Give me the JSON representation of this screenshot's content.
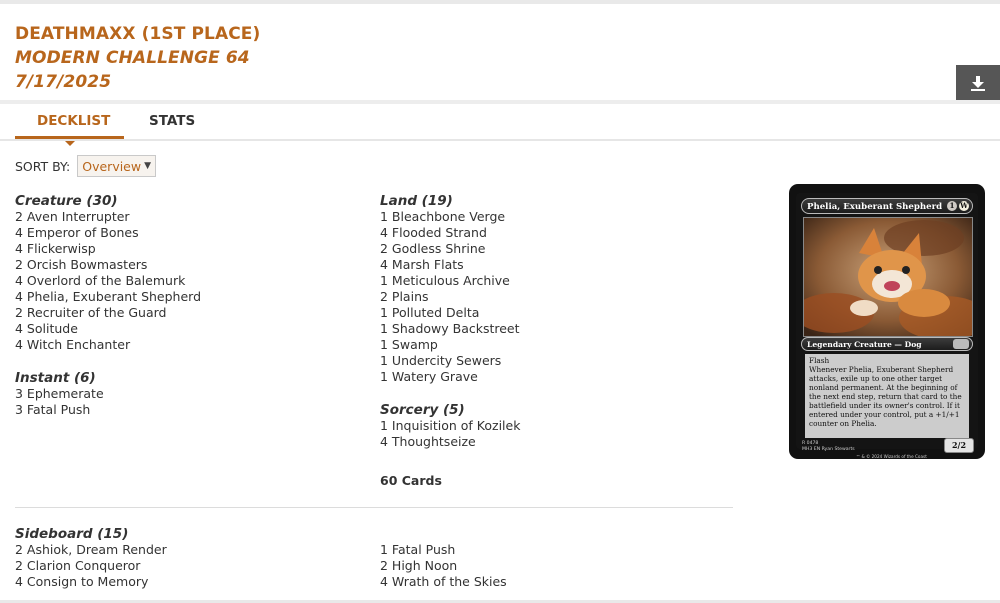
{
  "header": {
    "player": "DEATHMAXX (1ST PLACE)",
    "event": "MODERN CHALLENGE 64",
    "date": "7/17/2025"
  },
  "tabs": [
    {
      "label": "DECKLIST",
      "active": true
    },
    {
      "label": "STATS",
      "active": false
    }
  ],
  "sort": {
    "label": "SORT BY:",
    "selected": "Overview"
  },
  "main_left": [
    {
      "title": "Creature (30)",
      "cards": [
        "2 Aven Interrupter",
        "4 Emperor of Bones",
        "4 Flickerwisp",
        "2 Orcish Bowmasters",
        "4 Overlord of the Balemurk",
        "4 Phelia, Exuberant Shepherd",
        "2 Recruiter of the Guard",
        "4 Solitude",
        "4 Witch Enchanter"
      ]
    },
    {
      "title": "Instant (6)",
      "cards": [
        "3 Ephemerate",
        "3 Fatal Push"
      ]
    }
  ],
  "main_right": [
    {
      "title": "Land (19)",
      "cards": [
        "1 Bleachbone Verge",
        "4 Flooded Strand",
        "2 Godless Shrine",
        "4 Marsh Flats",
        "1 Meticulous Archive",
        "2 Plains",
        "1 Polluted Delta",
        "1 Shadowy Backstreet",
        "1 Swamp",
        "1 Undercity Sewers",
        "1 Watery Grave"
      ]
    },
    {
      "title": "Sorcery (5)",
      "cards": [
        "1 Inquisition of Kozilek",
        "4 Thoughtseize"
      ]
    }
  ],
  "total": "60 Cards",
  "sideboard": {
    "title": "Sideboard (15)",
    "left": [
      "2 Ashiok, Dream Render",
      "2 Clarion Conqueror",
      "4 Consign to Memory"
    ],
    "right": [
      "1 Fatal Push",
      "2 High Noon",
      "4 Wrath of the Skies"
    ]
  },
  "card_preview": {
    "name": "Phelia, Exuberant Shepherd",
    "mana": [
      "1",
      "W"
    ],
    "type_line": "Legendary Creature — Dog",
    "rules": [
      "Flash",
      "Whenever Phelia, Exuberant Shepherd attacks, exile up to one other target nonland permanent. At the beginning of the next end step, return that card to the battlefield under its owner's control. If it entered under your control, put a +1/+1 counter on Phelia."
    ],
    "pt": "2/2",
    "footer_line1": "R 0478",
    "footer_line2": "MH3 EN Ryan Stewarts",
    "copyright": "™ & © 2024 Wizards of the Coast"
  }
}
